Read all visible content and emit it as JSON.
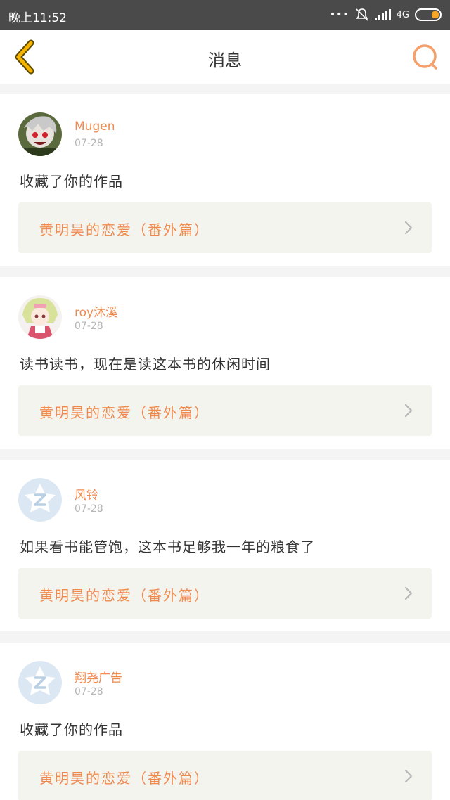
{
  "status_bar": {
    "time": "晚上11:52",
    "network": "4G"
  },
  "header": {
    "title": "消息"
  },
  "messages": [
    {
      "username": "Mugen",
      "date": "07-28",
      "text": "收藏了你的作品",
      "link": "黄明昊的恋爱（番外篇）",
      "avatar": "anime-avatar"
    },
    {
      "username": "roy沐溪",
      "date": "07-28",
      "text": "读书读书，现在是读这本书的休闲时间",
      "link": "黄明昊的恋爱（番外篇）",
      "avatar": "anime-avatar"
    },
    {
      "username": "风铃",
      "date": "07-28",
      "text": "如果看书能管饱，这本书足够我一年的粮食了",
      "link": "黄明昊的恋爱（番外篇）",
      "avatar": "default-avatar"
    },
    {
      "username": "翔尧广告",
      "date": "07-28",
      "text": "收藏了你的作品",
      "link": "黄明昊的恋爱（番外篇）",
      "avatar": "default-avatar"
    }
  ],
  "colors": {
    "accent": "#ef8a4f",
    "back_icon": "#f5b400",
    "status_bar": "#4a4a4a"
  }
}
